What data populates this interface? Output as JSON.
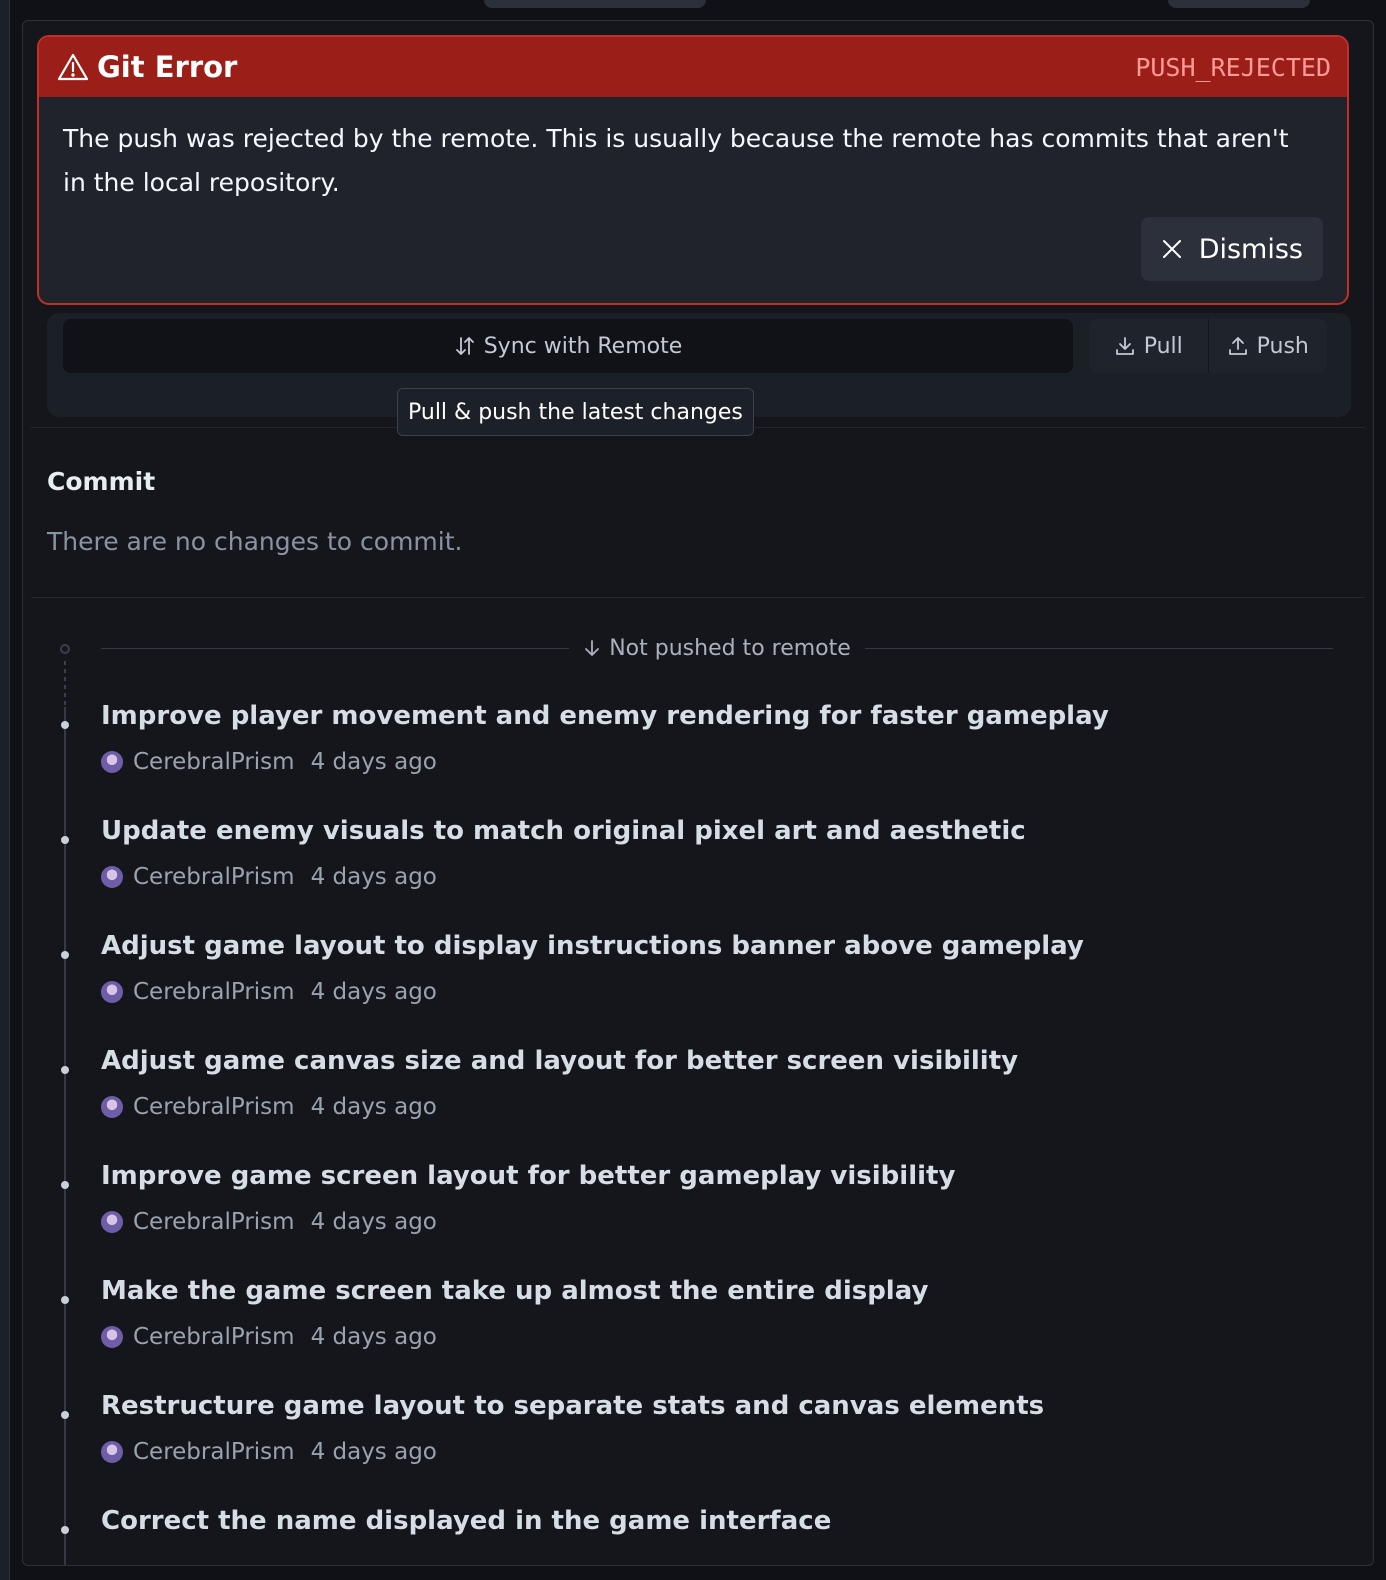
{
  "error": {
    "title": "Git Error",
    "code": "PUSH_REJECTED",
    "message": "The push was rejected by the remote. This is usually because the remote has commits that aren't in the local repository.",
    "dismiss_label": "Dismiss"
  },
  "sync": {
    "sync_label": "Sync with Remote",
    "pull_label": "Pull",
    "push_label": "Push",
    "tooltip": "Pull & push the latest changes"
  },
  "commit": {
    "title": "Commit",
    "empty_message": "There are no changes to commit."
  },
  "history": {
    "separator_label": "Not pushed to remote",
    "commits": [
      {
        "message": "Improve player movement and enemy rendering for faster gameplay",
        "author": "CerebralPrism",
        "time": "4 days ago"
      },
      {
        "message": "Update enemy visuals to match original pixel art and aesthetic",
        "author": "CerebralPrism",
        "time": "4 days ago"
      },
      {
        "message": "Adjust game layout to display instructions banner above gameplay",
        "author": "CerebralPrism",
        "time": "4 days ago"
      },
      {
        "message": "Adjust game canvas size and layout for better screen visibility",
        "author": "CerebralPrism",
        "time": "4 days ago"
      },
      {
        "message": "Improve game screen layout for better gameplay visibility",
        "author": "CerebralPrism",
        "time": "4 days ago"
      },
      {
        "message": "Make the game screen take up almost the entire display",
        "author": "CerebralPrism",
        "time": "4 days ago"
      },
      {
        "message": "Restructure game layout to separate stats and canvas elements",
        "author": "CerebralPrism",
        "time": "4 days ago"
      },
      {
        "message": "Correct the name displayed in the game interface",
        "author": "",
        "time": ""
      }
    ]
  },
  "colors": {
    "error_header": "#9b1f18",
    "error_border": "#c03026",
    "error_code": "#ff9a94",
    "background": "#14161c"
  },
  "icons": {
    "warning": "warning-icon",
    "close": "close-icon",
    "sync": "sync-arrows-icon",
    "pull": "download-icon",
    "push": "upload-icon",
    "arrow_down": "arrow-down-icon"
  }
}
